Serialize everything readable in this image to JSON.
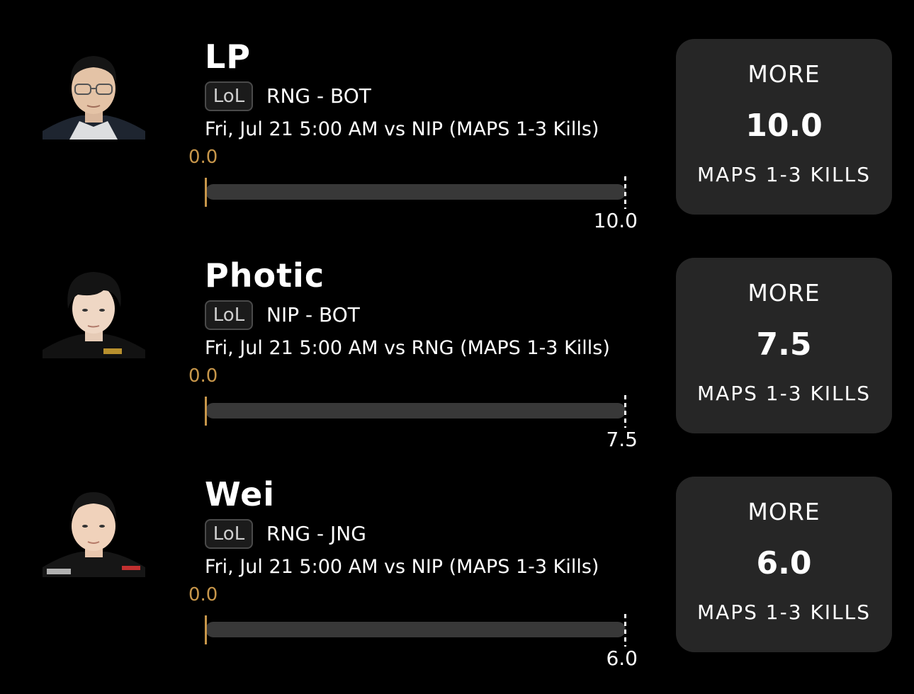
{
  "players": [
    {
      "name": "LP",
      "game": "LoL",
      "team_position": "RNG - BOT",
      "matchup": "Fri, Jul 21 5:00 AM  vs NIP (MAPS 1-3 Kills)",
      "progress": {
        "current_label": "0.0",
        "max_label": "10.0",
        "current": 0.0,
        "max": 10.0
      },
      "card": {
        "direction": "MORE",
        "line": "10.0",
        "stat": "MAPS 1-3 KILLS"
      }
    },
    {
      "name": "Photic",
      "game": "LoL",
      "team_position": "NIP - BOT",
      "matchup": "Fri, Jul 21 5:00 AM  vs RNG (MAPS 1-3 Kills)",
      "progress": {
        "current_label": "0.0",
        "max_label": "7.5",
        "current": 0.0,
        "max": 7.5
      },
      "card": {
        "direction": "MORE",
        "line": "7.5",
        "stat": "MAPS 1-3 KILLS"
      }
    },
    {
      "name": "Wei",
      "game": "LoL",
      "team_position": "RNG - JNG",
      "matchup": "Fri, Jul 21 5:00 AM  vs NIP (MAPS 1-3 Kills)",
      "progress": {
        "current_label": "0.0",
        "max_label": "6.0",
        "current": 0.0,
        "max": 6.0
      },
      "card": {
        "direction": "MORE",
        "line": "6.0",
        "stat": "MAPS 1-3 KILLS"
      }
    }
  ],
  "colors": {
    "background": "#000000",
    "card": "#262626",
    "track": "#383838",
    "accent": "#c7964a",
    "text": "#ffffff"
  },
  "icons": {
    "avatar": "player-headshot"
  }
}
